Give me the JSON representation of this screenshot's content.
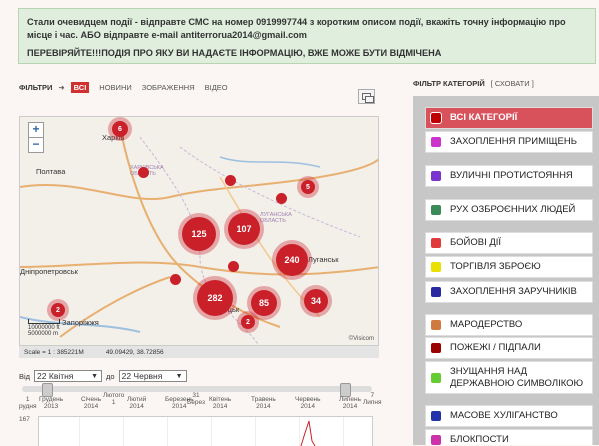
{
  "notice": {
    "line1": "Стали очевидцем події - відправте СМС на номер 0919997744 з коротким описом події, вкажіть точну інформацію про місце і час. АБО відправте e-mail antiterrorua2014@gmail.com",
    "line2": "ПЕРЕВІРЯЙТЕ!!!ПОДІЯ ПРО ЯКУ ВИ НАДАЄТЕ ІНФОРМАЦІЮ, ВЖЕ МОЖЕ БУТИ ВІДМІЧЕНА"
  },
  "filters": {
    "label": "ФІЛЬТРИ",
    "arrow": "➜",
    "tabs": [
      "ВСІ",
      "НОВИНИ",
      "ЗОБРАЖЕННЯ",
      "ВІДЕО"
    ]
  },
  "map": {
    "zoom_in": "+",
    "zoom_out": "−",
    "places": [
      "Харків",
      "Полтава",
      "ХАРКІВСЬКА ОБЛАСТЬ",
      "ЛУГАНСЬКА ОБЛАСТЬ",
      "Луганськ",
      "Дніпропетровськ",
      "Донецьк",
      "Запоріжжя"
    ],
    "clusters": [
      "6",
      "125",
      "107",
      "240",
      "282",
      "85",
      "34",
      "5",
      "2",
      "2"
    ],
    "scale_labels": [
      "10000000 ft",
      "5000000 m"
    ],
    "copyright": "©Visicom",
    "status_scale": "Scale = 1 : 385221M",
    "status_coords": "49.09429, 38.72856"
  },
  "dates": {
    "from_label": "Від",
    "from_value": "22 Квітня",
    "to_label": "до",
    "to_value": "22 Червня"
  },
  "timeline": {
    "ticks": [
      {
        "top": "1",
        "bottom": "рудня"
      },
      {
        "top": "Грудень",
        "bottom": "2013"
      },
      {
        "top": "Січень",
        "bottom": "2014"
      },
      {
        "top": "Лютого",
        "bottom": "1"
      },
      {
        "top": "Лютий",
        "bottom": "2014"
      },
      {
        "top": "Березень",
        "bottom": "2014"
      },
      {
        "top": "31",
        "bottom": "Берез"
      },
      {
        "top": "Квітень",
        "bottom": "2014"
      },
      {
        "top": "Травень",
        "bottom": "2014"
      },
      {
        "top": "Червень",
        "bottom": "2014"
      },
      {
        "top": "Липень",
        "bottom": "2014"
      },
      {
        "top": "7",
        "bottom": "Липня"
      }
    ],
    "ymax": "167"
  },
  "panel": {
    "title": "ФІЛЬТР КАТЕГОРІЙ",
    "hide": "[ СХОВАТИ ]",
    "categories": [
      {
        "label": "ВСІ КАТЕГОРІЇ",
        "color": "#c00000",
        "active": true
      },
      {
        "label": "ЗАХОПЛЕННЯ ПРИМІЩЕНЬ",
        "color": "#cc33cc"
      },
      {
        "label": "ВУЛИЧНІ ПРОТИСТОЯННЯ",
        "color": "#7a33cc"
      },
      {
        "label": "РУХ ОЗБРОЄННИХ ЛЮДЕЙ",
        "color": "#3a8a5a"
      },
      {
        "label": "БОЙОВІ ДІЇ",
        "color": "#e03a3a"
      },
      {
        "label": "ТОРГІВЛЯ ЗБРОЄЮ",
        "color": "#e8e000"
      },
      {
        "label": "ЗАХОПЛЕННЯ ЗАРУЧНИКІВ",
        "color": "#2a2aa0"
      },
      {
        "label": "МАРОДЕРСТВО",
        "color": "#d07a40"
      },
      {
        "label": "ПОЖЕЖІ / ПІДПАЛИ",
        "color": "#9a0000"
      },
      {
        "label": "ЗНУЩАННЯ НАД ДЕРЖАВНОЮ СИМВОЛІКОЮ",
        "color": "#66cc33"
      },
      {
        "label": "МАСОВЕ ХУЛІГАНСТВО",
        "color": "#2233aa"
      },
      {
        "label": "БЛОКПОСТИ",
        "color": "#cc33aa"
      }
    ]
  }
}
